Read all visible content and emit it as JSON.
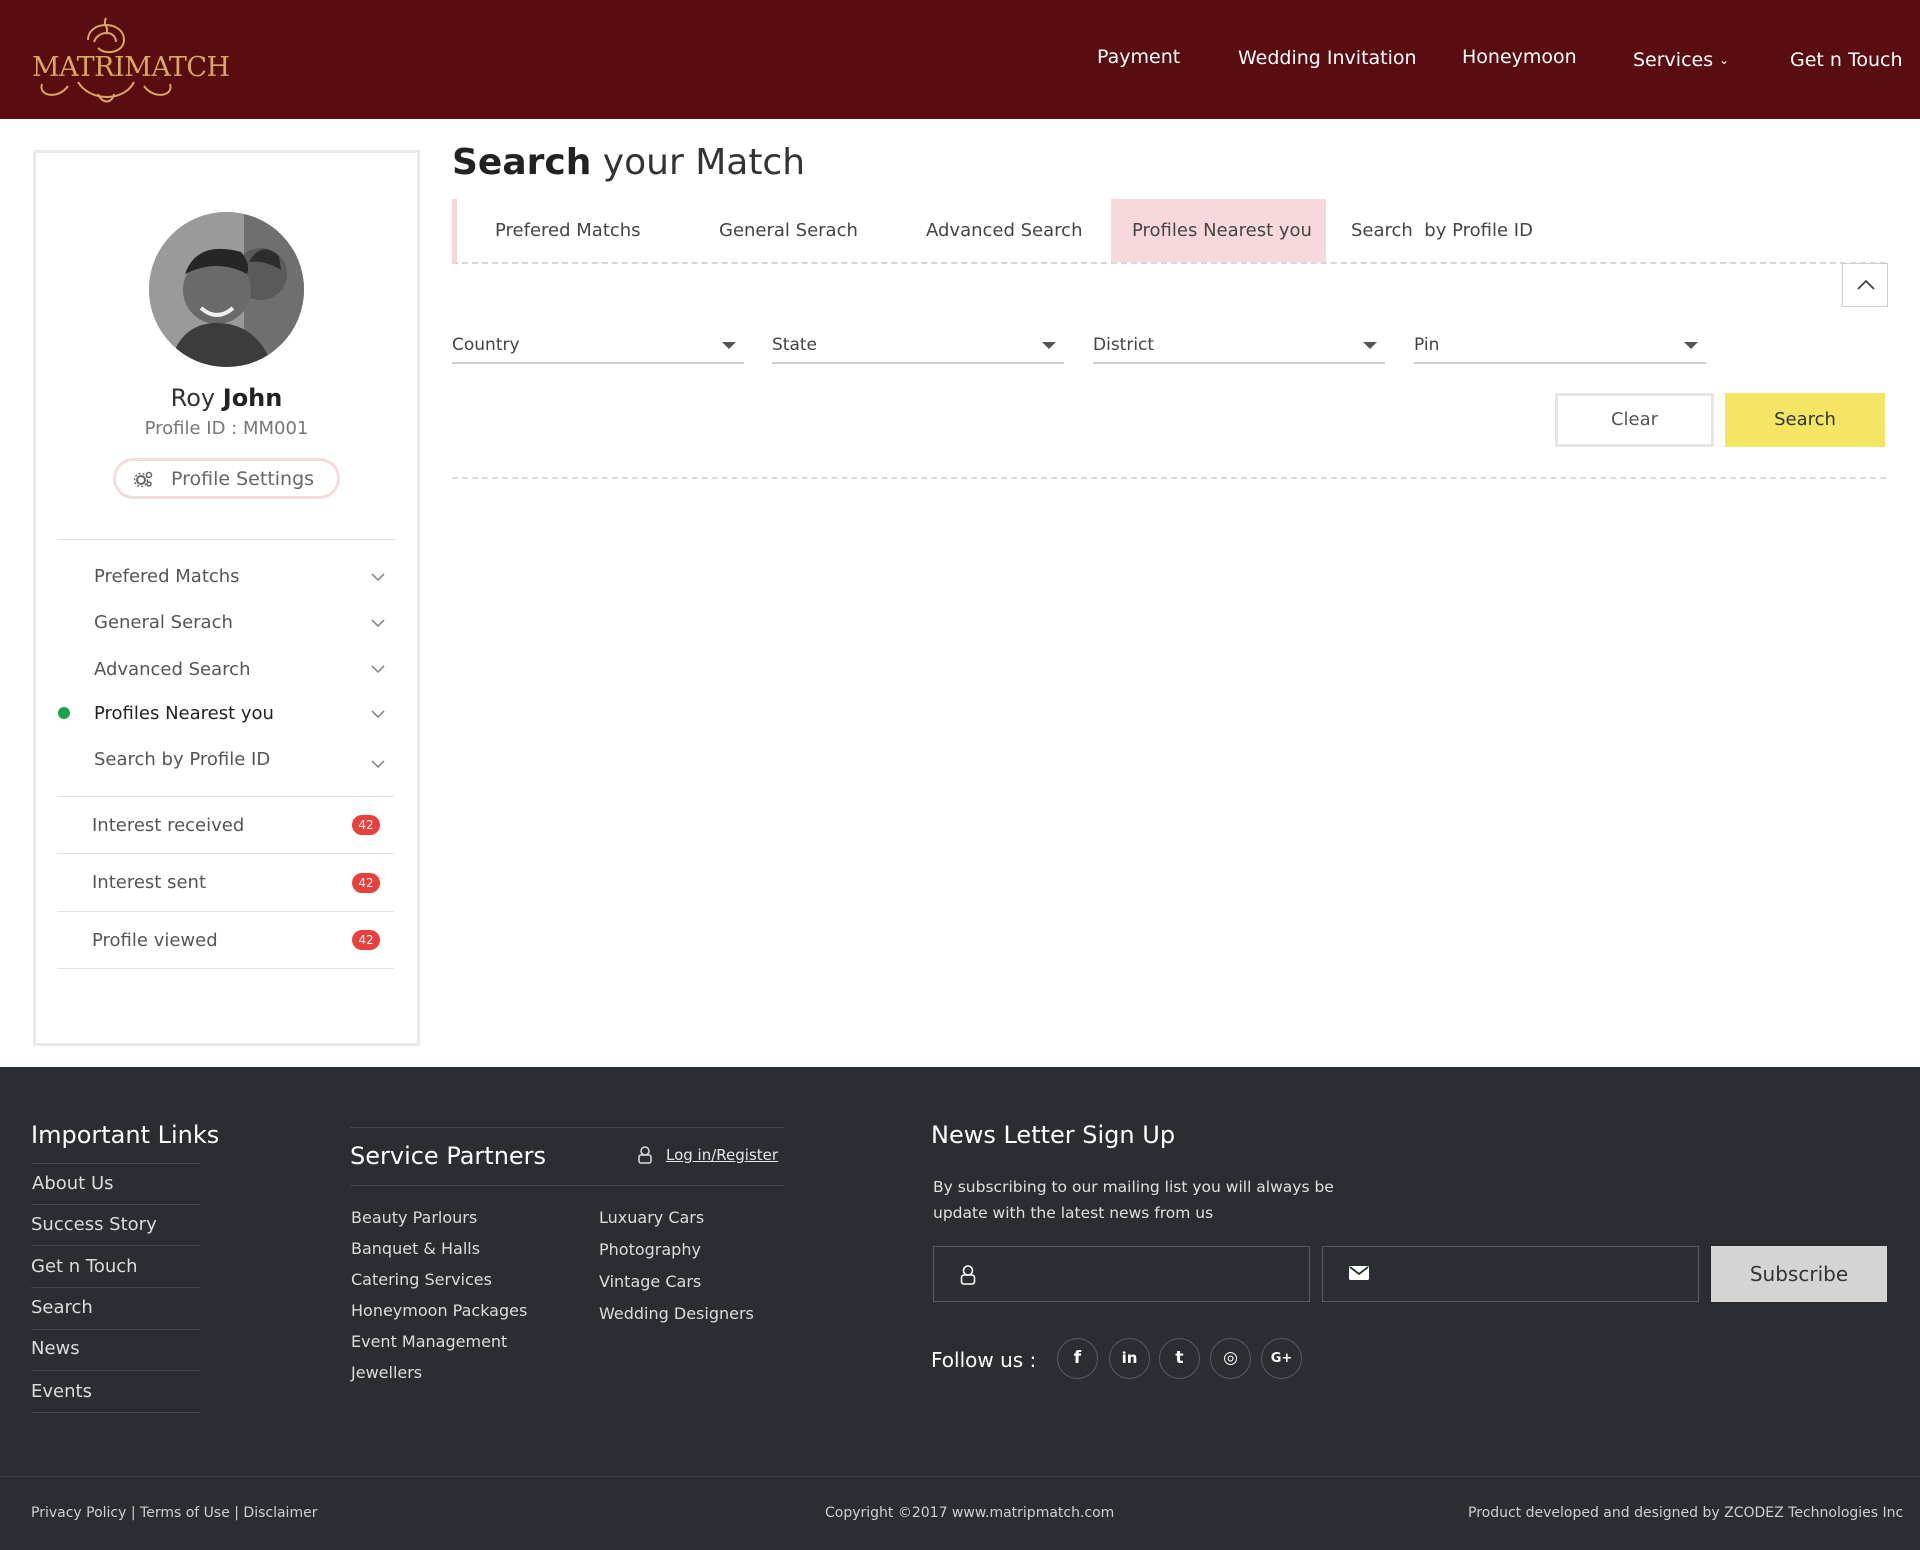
{
  "brand": {
    "logo_text": "MATRIMATCH"
  },
  "nav": {
    "payment": "Payment",
    "wedding_invitation": "Wedding Invitation",
    "honeymoon": "Honeymoon",
    "services": "Services",
    "get_n_touch": "Get n Touch"
  },
  "profile": {
    "first_name": "Roy",
    "last_name": "John",
    "profile_id": "Profile ID : MM001",
    "settings_label": "Profile Settings"
  },
  "sidebar": {
    "menu": [
      {
        "label": "Prefered Matchs"
      },
      {
        "label": "General Serach"
      },
      {
        "label": "Advanced Search"
      },
      {
        "label": "Profiles Nearest you",
        "active": true
      },
      {
        "label": "Search by Profile ID"
      }
    ],
    "counters": [
      {
        "label": "Interest received",
        "count": "42"
      },
      {
        "label": "Interest sent",
        "count": "42"
      },
      {
        "label": "Profile viewed",
        "count": "42"
      }
    ]
  },
  "main": {
    "title_bold": "Search",
    "title_rest": " your Match",
    "tabs": [
      {
        "label": "Prefered Matchs"
      },
      {
        "label": "General Serach"
      },
      {
        "label": "Advanced Search"
      },
      {
        "label": "Profiles Nearest you",
        "active": true
      },
      {
        "label": "Search  by Profile ID"
      }
    ],
    "filters": {
      "country": "Country",
      "state": "State",
      "district": "District",
      "pin": "Pin"
    },
    "clear_label": "Clear",
    "search_label": "Search"
  },
  "footer": {
    "important_links": {
      "title": "Important Links",
      "links": [
        "About Us",
        "Success Story",
        "Get n Touch",
        "Search",
        "News",
        "Events"
      ]
    },
    "service_partners": {
      "title": "Service Partners",
      "login_label": "Log in/Register",
      "col1": [
        "Beauty Parlours",
        "Banquet & Halls",
        "Catering Services",
        "Honeymoon Packages",
        "Event Management",
        "Jewellers"
      ],
      "col2": [
        "Luxuary Cars",
        "Photography",
        "Vintage Cars",
        "Wedding Designers"
      ]
    },
    "newsletter": {
      "title": "News Letter Sign Up",
      "text": "By subscribing to our mailing list you will always be update with the latest news from us",
      "subscribe_label": "Subscribe",
      "follow_label": "Follow us :"
    },
    "social": [
      {
        "icon": "facebook-icon",
        "glyph": "f"
      },
      {
        "icon": "linkedin-icon",
        "glyph": "in"
      },
      {
        "icon": "twitter-icon",
        "glyph": "t"
      },
      {
        "icon": "instagram-icon",
        "glyph": "◎"
      },
      {
        "icon": "google-plus-icon",
        "glyph": "G+"
      }
    ],
    "bottom": {
      "policy": "Privacy Policy | Terms of Use | Disclaimer",
      "copyright": "Copyright ©2017 www.matripmatch.com",
      "credit": "Product developed and designed by ZCODEZ Technologies Inc"
    }
  },
  "colors": {
    "header_bg": "#590d11",
    "logo_gold": "#d7a860",
    "active_tab_bg": "#f7d9db",
    "search_button": "#f5e565",
    "badge": "#e8403c",
    "active_dot": "#1aa34a",
    "footer_bg": "#2a2e32"
  }
}
